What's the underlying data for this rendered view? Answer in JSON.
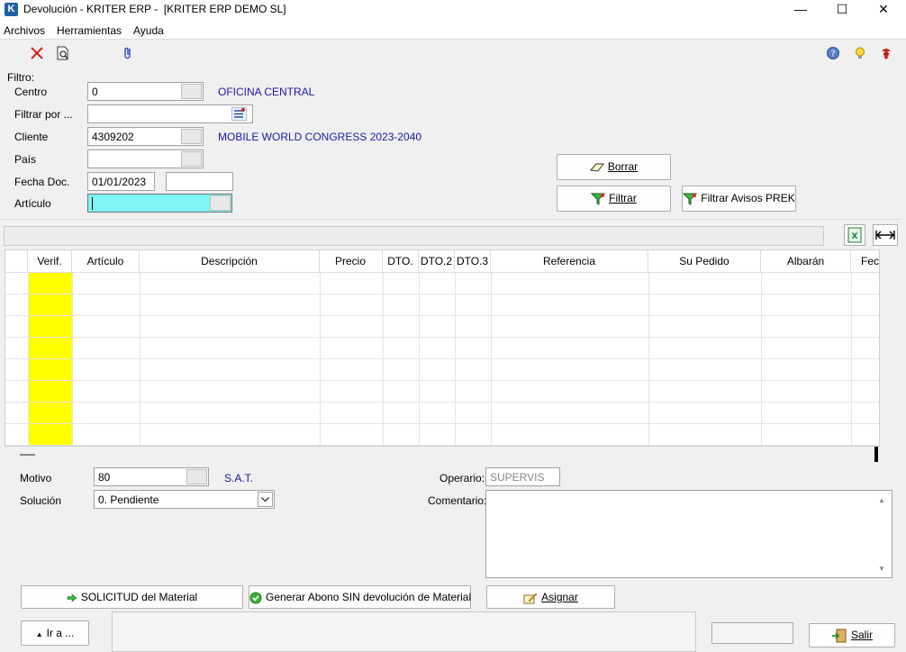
{
  "window": {
    "icon_letter": "K",
    "title": "Devolución - KRITER ERP -  [KRITER ERP DEMO SL]",
    "minimize": "—",
    "maximize": "☐",
    "close": "✕"
  },
  "menu": [
    "Archivos",
    "Herramientas",
    "Ayuda"
  ],
  "toolbar": {
    "icons": [
      "delete-icon",
      "preview-icon",
      "attach-icon",
      "help-icon",
      "tip-icon",
      "support-icon"
    ]
  },
  "filter": {
    "title": "Filtro:",
    "centro": {
      "label": "Centro",
      "value": "0",
      "desc": "OFICINA CENTRAL"
    },
    "filtrar_por": {
      "label": "Filtrar por ...",
      "value": ""
    },
    "cliente": {
      "label": "Cliente",
      "value": "4309202",
      "desc": "MOBILE WORLD CONGRESS 2023-2040"
    },
    "pais": {
      "label": "País",
      "value": ""
    },
    "fecha_doc": {
      "label": "Fecha Doc.",
      "from": "01/01/2023",
      "to": ""
    },
    "articulo": {
      "label": "Artículo",
      "value": ""
    },
    "borrar_label": "Borrar",
    "filtrar_label": "Filtrar",
    "filtrar_avisos_label": "Filtrar Avisos PREK"
  },
  "grid": {
    "columns": [
      "Verif.",
      "Artículo",
      "Descripción",
      "Precio",
      "DTO.",
      "DTO.2",
      "DTO.3",
      "Referencia",
      "Su Pedido",
      "Albarán",
      "Fec"
    ],
    "row_count": 8
  },
  "bottom": {
    "motivo": {
      "label": "Motivo",
      "value": "80",
      "desc": "S.A.T."
    },
    "solucion": {
      "label": "Solución",
      "value": "0. Pendiente"
    },
    "operario": {
      "label": "Operario:",
      "value": "SUPERVIS"
    },
    "comentario": {
      "label": "Comentario:",
      "value": ""
    },
    "btn_solicitud": "SOLICITUD del Material",
    "btn_generar": "Generar Abono SIN devolución de Material",
    "btn_asignar": "Asignar",
    "btn_ira": "Ir a ...",
    "btn_salir": "Salir"
  },
  "colors": {
    "accent_blue": "#1a1aa6",
    "verif_yellow": "#ffff00",
    "article_cyan": "#7ff5f5",
    "close_red": "#d0201a"
  }
}
